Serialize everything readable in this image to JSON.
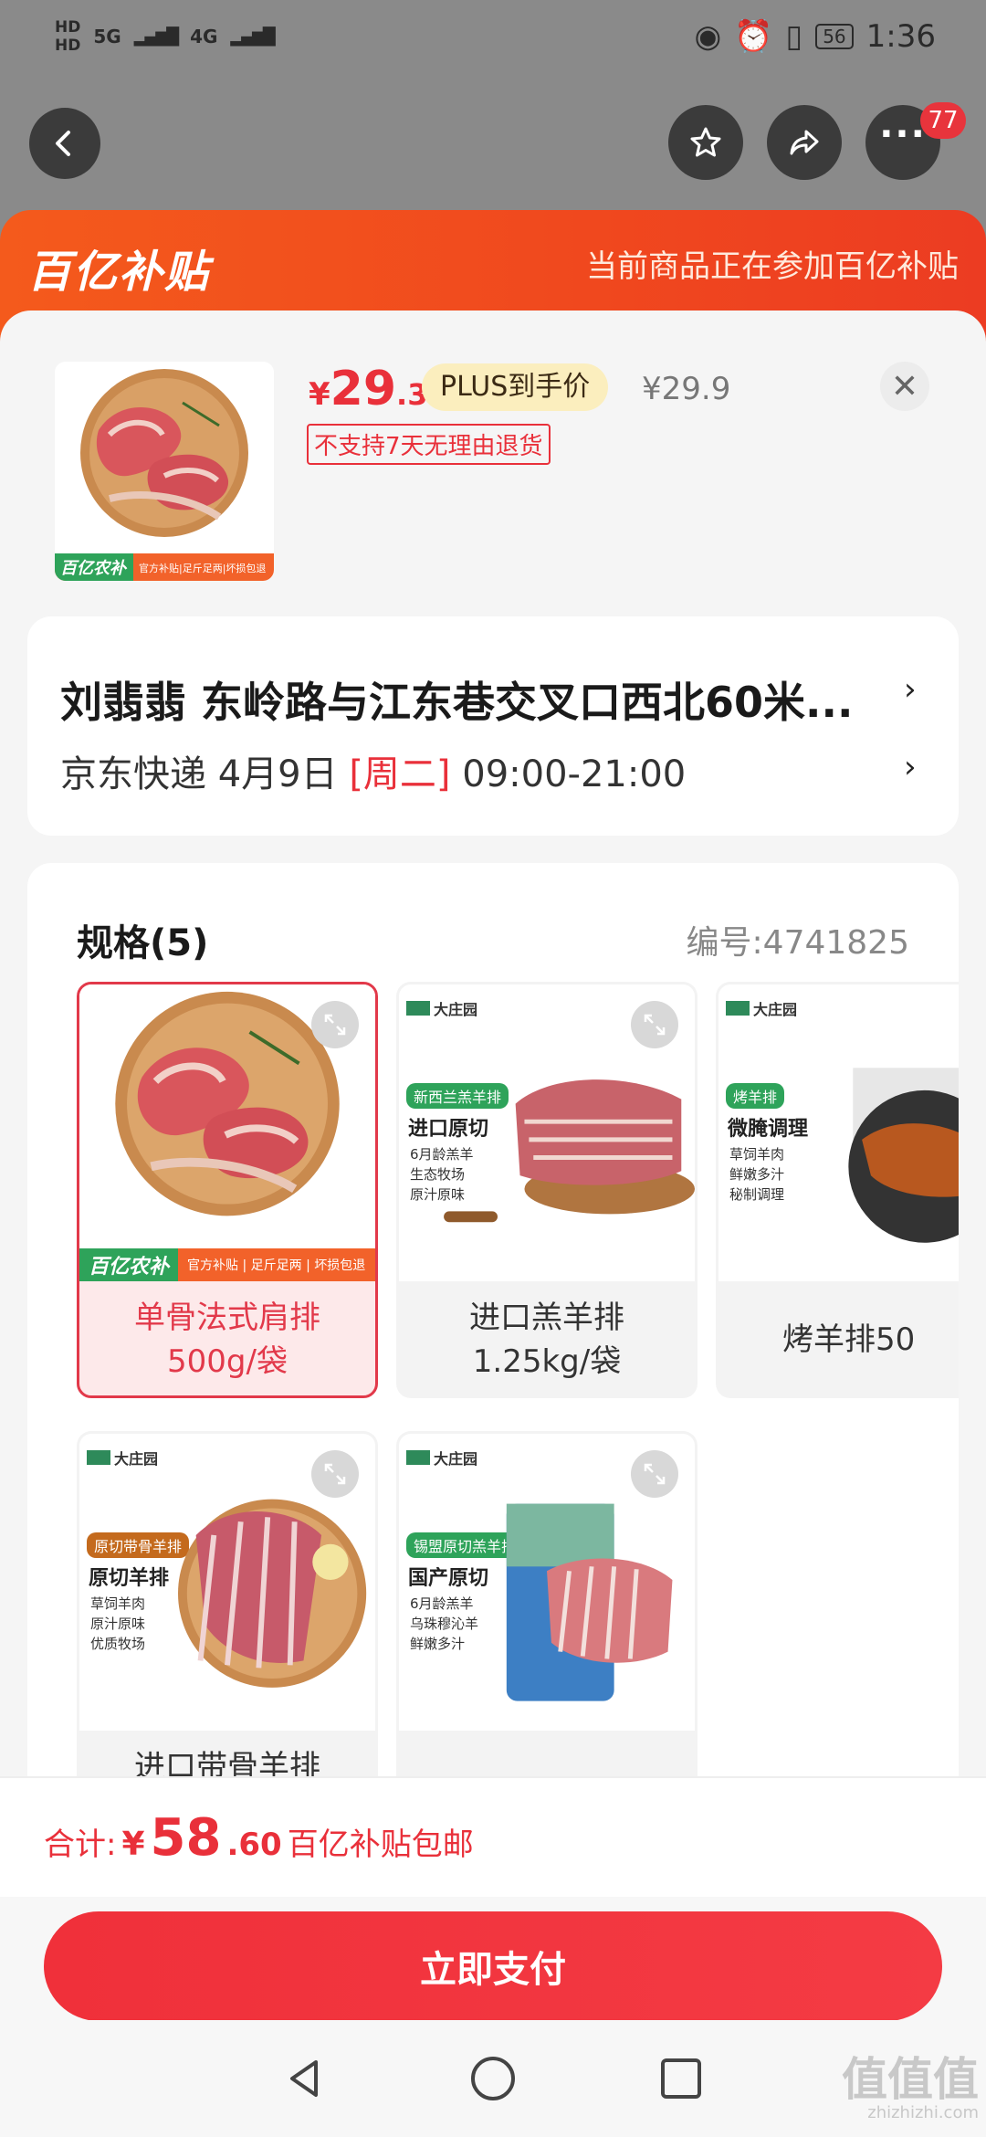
{
  "status_bar": {
    "hd1": "HD",
    "hd2": "HD",
    "net1": "5G",
    "net2": "4G",
    "battery": "56",
    "time": "1:36"
  },
  "top_nav": {
    "badge": "77"
  },
  "header": {
    "logo": "百亿补贴",
    "note": "当前商品正在参加百亿补贴"
  },
  "product": {
    "price_currency": "¥",
    "price_int": "29",
    "price_dec": ".3",
    "plus_label": "PLUS到手价",
    "original_price": "¥29.9",
    "no_return": "不支持7天无理由退货"
  },
  "address": {
    "line": "刘翡翡  东岭路与江东巷交叉口西北60米...",
    "delivery_prefix": "京东快递 4月9日 ",
    "delivery_day": "[周二]",
    "delivery_time": " 09:00-21:00"
  },
  "spec": {
    "title": "规格(5)",
    "code": "编号:4741825",
    "options": [
      {
        "label_line1": "单骨法式肩排",
        "label_line2": "500g/袋"
      },
      {
        "label_line1": "进口羔羊排",
        "label_line2": "1.25kg/袋",
        "brand": "大庄园",
        "pill": "新西兰羔羊排",
        "head": "进口原切",
        "bullets": [
          "6月龄羔羊",
          "生态牧场",
          "原汁原味"
        ]
      },
      {
        "label_line1": "烤羊排50",
        "label_line2": "",
        "brand": "大庄园",
        "pill": "烤羊排",
        "head": "微腌调理",
        "bullets": [
          "草饲羊肉",
          "鲜嫩多汁",
          "秘制调理"
        ]
      },
      {
        "label_line1": "进口带骨羊排",
        "label_line2": "",
        "brand": "大庄园",
        "pill": "原切带骨羊排",
        "head": "原切羊排",
        "bullets": [
          "草饲羊肉",
          "原汁原味",
          "优质牧场"
        ]
      },
      {
        "label_line1": "",
        "label_line2": "",
        "brand": "大庄园",
        "pill": "锡盟原切羔羊排",
        "head": "国产原切",
        "bullets": [
          "6月龄羔羊",
          "乌珠穆沁羊",
          "鲜嫩多汁"
        ]
      }
    ],
    "subsidy_logo": "百亿农补",
    "subsidy_text": "官方补贴 | 足斤足两 | 坏损包退"
  },
  "total": {
    "prefix": "合计: ",
    "currency": "¥",
    "amount_int": "58",
    "amount_dec": ".60",
    "suffix": "百亿补贴包邮"
  },
  "pay_button": "立即支付",
  "watermark": {
    "main": "值值值",
    "sub": "zhizhizhi.com"
  },
  "colors": {
    "accent_red": "#e9303a",
    "header_orange": "#f0481e"
  }
}
